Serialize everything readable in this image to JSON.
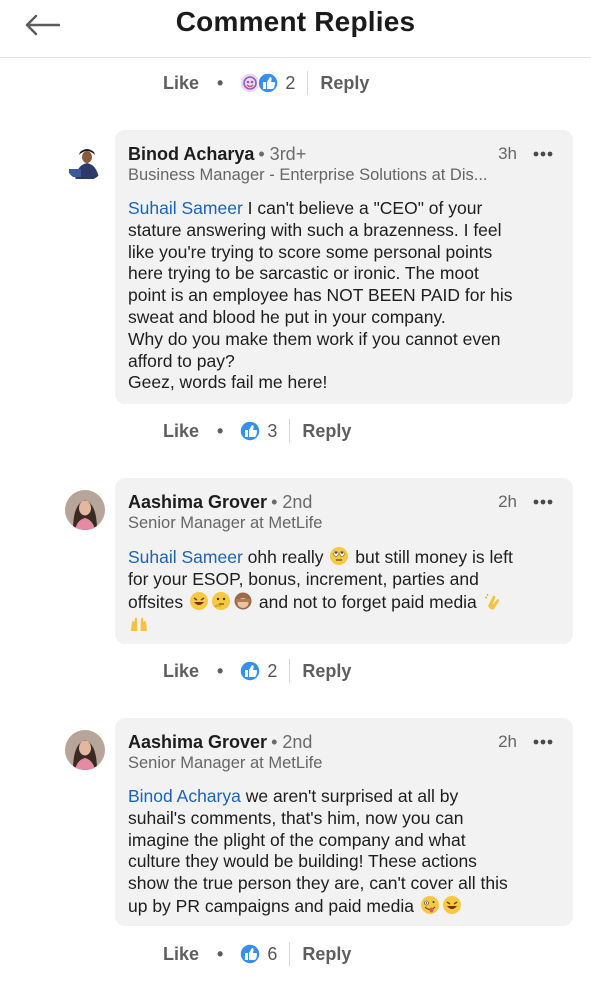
{
  "header": {
    "title": "Comment Replies"
  },
  "top_actions": {
    "like": "Like",
    "dot": "•",
    "count": "2",
    "reply": "Reply"
  },
  "comments": [
    {
      "author": "Binod Acharya",
      "degree": "• 3rd+",
      "time": "3h",
      "headline": "Business Manager - Enterprise Solutions at Dis...",
      "mention": "Suhail Sameer",
      "text1": " I can't believe a \"CEO\" of your",
      "lines": [
        "stature answering with such a brazenness.  I feel",
        "like you're trying to score some personal points",
        "here trying to be sarcastic or ironic. The moot",
        "point is an employee has NOT BEEN PAID for his",
        "sweat and blood he put in your company.",
        "Why do you make them work if you cannot even",
        "afford to pay?",
        "Geez, words fail me here!"
      ],
      "actions": {
        "like": "Like",
        "dot": "•",
        "count": "3",
        "reply": "Reply"
      }
    },
    {
      "author": "Aashima Grover",
      "degree": "• 2nd",
      "time": "2h",
      "headline": "Senior Manager at MetLife",
      "mention": "Suhail Sameer",
      "text1": " ohh really",
      "text1b": " but still money is left",
      "line2": "for your ESOP, bonus, increment, parties and",
      "line3a": "offsites",
      "line3b": " and not to forget paid media",
      "actions": {
        "like": "Like",
        "dot": "•",
        "count": "2",
        "reply": "Reply"
      }
    },
    {
      "author": "Aashima Grover",
      "degree": "• 2nd",
      "time": "2h",
      "headline": "Senior Manager at MetLife",
      "mention": "Binod Acharya",
      "text1": " we aren't surprised at all by",
      "lines": [
        "suhail's comments, that's him, now you can",
        "imagine the plight of the company and what",
        "culture they would be building! These actions",
        "show the true person they are, can't cover all this"
      ],
      "last_line": "up by PR campaigns and paid media",
      "actions": {
        "like": "Like",
        "dot": "•",
        "count": "6",
        "reply": "Reply"
      }
    }
  ],
  "icons": {
    "back": "back-arrow-icon",
    "more": "more-dots-icon",
    "like_reaction": "like-reaction-icon",
    "support_reaction": "support-reaction-icon"
  },
  "colors": {
    "mention": "#1a63b8",
    "reaction_blue": "#378fe9",
    "bubble": "#f2f2f2"
  }
}
